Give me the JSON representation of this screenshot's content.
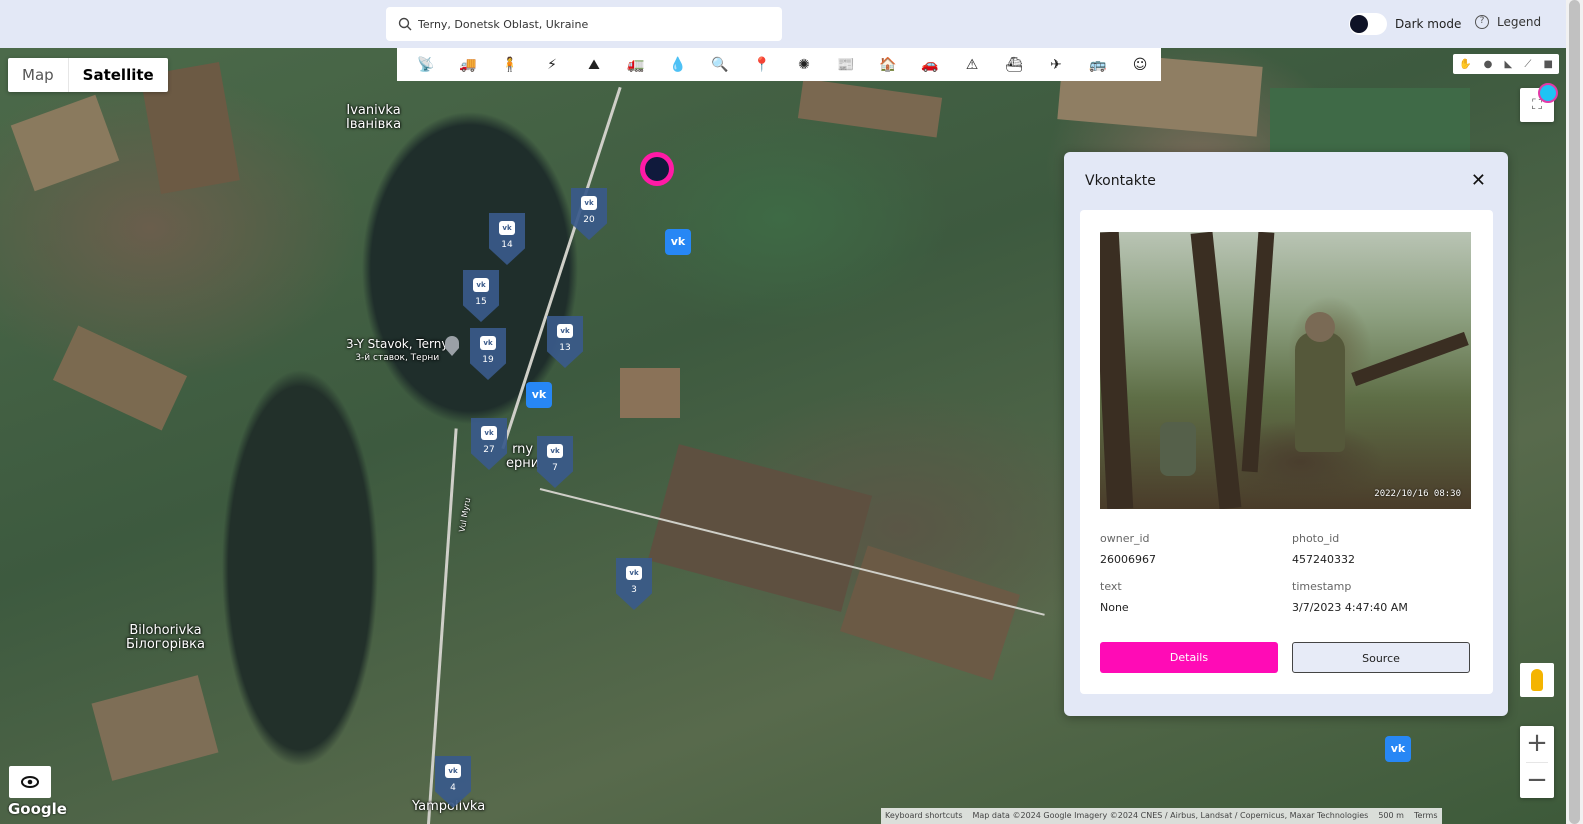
{
  "search": {
    "value": "Terny, Donetsk Oblast, Ukraine"
  },
  "header": {
    "dark_mode_label": "Dark mode",
    "legend_label": "Legend"
  },
  "map_type": {
    "options": [
      "Map",
      "Satellite"
    ],
    "selected": "Satellite"
  },
  "toolbar": {
    "icons": [
      "antenna-icon",
      "military-truck-icon",
      "soldier-icon",
      "lightning-icon",
      "tank-icon",
      "truck-icon",
      "drop-icon",
      "search-icon",
      "location-pin-icon",
      "sun-icon",
      "newspaper-icon",
      "house-icon",
      "car-icon",
      "warning-icon",
      "ship-icon",
      "plane-icon",
      "bus-icon",
      "face-icon"
    ],
    "glyphs": [
      "📡",
      "🚚",
      "🧍",
      "⚡",
      "⛰",
      "🚛",
      "💧",
      "🔍",
      "📍",
      "✺",
      "📰",
      "🏠",
      "🚗",
      "⚠",
      "⛴",
      "✈",
      "🚌",
      "☺"
    ]
  },
  "map_labels": {
    "ivanivka_en": "Ivanivka",
    "ivanivka_uk": "Іванівка",
    "stavok_en": "3-Y Stavok, Terny",
    "stavok_uk": "3-й ставок, Терни",
    "terny_en": "rny",
    "terny_uk": "ерни",
    "bilohorivka_en": "Bilohorivka",
    "bilohorivka_uk": "Білогорівка",
    "yampolivka": "Yampolivka",
    "road": "Vul Myru",
    "google": "Google"
  },
  "markers": [
    {
      "label": "20"
    },
    {
      "label": "14"
    },
    {
      "label": "15"
    },
    {
      "label": "13"
    },
    {
      "label": "19"
    },
    {
      "label": "27"
    },
    {
      "label": "7"
    },
    {
      "label": "3"
    },
    {
      "label": "4"
    }
  ],
  "attribution": [
    "Keyboard shortcuts",
    "Map data ©2024 Google Imagery ©2024 CNES / Airbus, Landsat / Copernicus, Maxar Technologies",
    "500 m",
    "Terms"
  ],
  "popup": {
    "title": "Vkontakte",
    "photo_timestamp": "2022/10/16  08:30",
    "fields": {
      "owner_id_label": "owner_id",
      "owner_id": "26006967",
      "photo_id_label": "photo_id",
      "photo_id": "457240332",
      "text_label": "text",
      "text": "None",
      "timestamp_label": "timestamp",
      "timestamp": "3/7/2023 4:47:40 AM"
    },
    "details_label": "Details",
    "source_label": "Source"
  },
  "colors": {
    "accent": "#ff0bb6",
    "marker": "#3a5a8a",
    "vk_blue": "#2787f5",
    "cyan_dot": "#1ec3f4"
  }
}
